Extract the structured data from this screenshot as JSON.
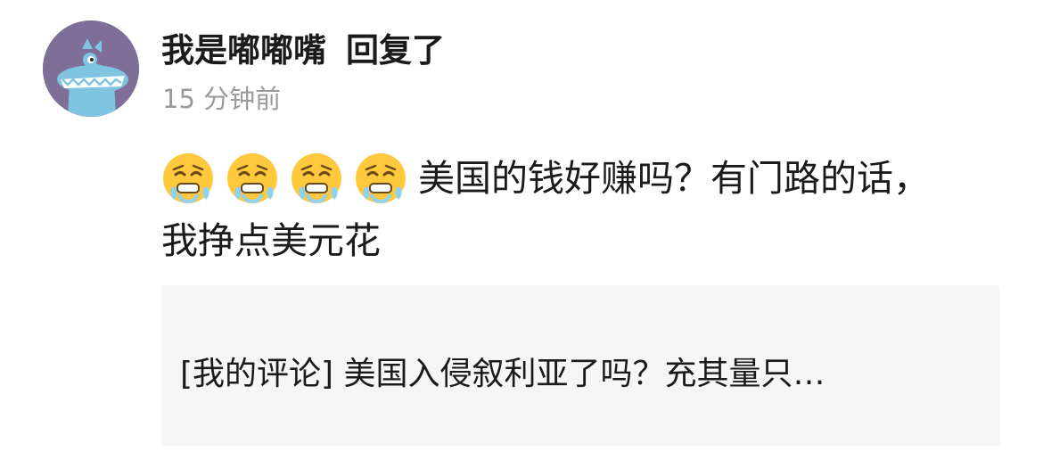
{
  "notification": {
    "username": "我是嘟嘟嘴",
    "action": "回复了",
    "timestamp": "15 分钟前"
  },
  "reply": {
    "emojis": [
      "tired-face-emoji",
      "tired-face-emoji",
      "tired-face-emoji",
      "tired-face-emoji"
    ],
    "text": "美国的钱好赚吗？有门路的话，我挣点美元花"
  },
  "quoted_comment": {
    "text": "[我的评论] 美国入侵叙利亚了吗？充其量只…"
  },
  "colors": {
    "avatar_background": "#7f6f98",
    "avatar_creature": "#7fc4e0",
    "username": "#1b1b1b",
    "timestamp": "#9a9a9a",
    "quote_background": "#f6f6f6",
    "emoji_yellow": "#ffc83d"
  }
}
